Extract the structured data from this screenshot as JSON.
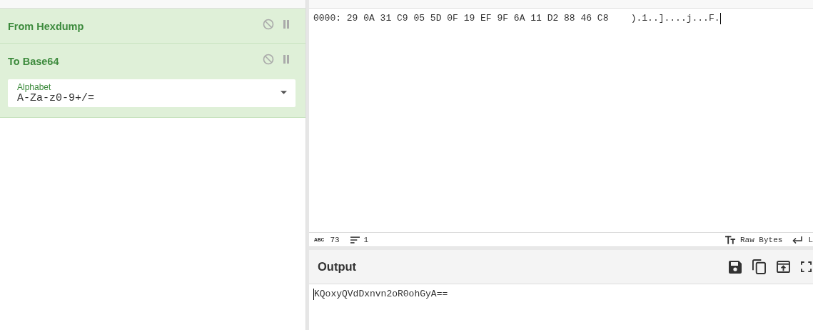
{
  "recipe": {
    "operations": [
      {
        "name": "From Hexdump",
        "disabled": false,
        "breakpoint": false
      },
      {
        "name": "To Base64",
        "disabled": false,
        "breakpoint": false,
        "args": [
          {
            "label": "Alphabet",
            "value": "A-Za-z0-9+/="
          }
        ]
      }
    ]
  },
  "input": {
    "text": "0000: 29 0A 31 C9 05 5D 0F 19 EF 9F 6A 11 D2 88 46 C8    ).1..]....j...F."
  },
  "status_bar": {
    "length_badge": "ABC",
    "length": "73",
    "lines": "1",
    "encoding": "Raw Bytes",
    "eol": "L"
  },
  "output": {
    "title": "Output",
    "text": "KQoxyQVdDxnvn2oR0ohGyA=="
  }
}
